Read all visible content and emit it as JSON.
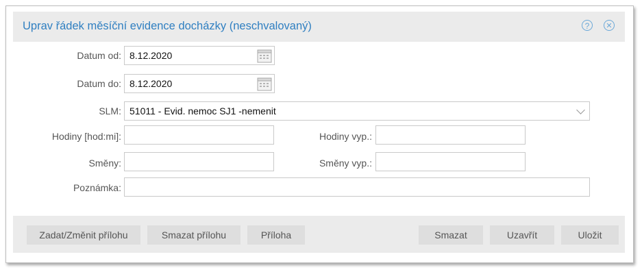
{
  "dialog": {
    "title": "Uprav řádek měsíční evidence docházky (neschvalovaný)",
    "help_icon": "question-circle-icon",
    "close_icon": "close-circle-icon",
    "accent_color": "#2f7fc1"
  },
  "form": {
    "datum_od": {
      "label": "Datum od:",
      "value": "8.12.2020"
    },
    "datum_do": {
      "label": "Datum do:",
      "value": "8.12.2020"
    },
    "slm": {
      "label": "SLM:",
      "value": "51011 - Evid. nemoc SJ1 -nemenit"
    },
    "hodiny": {
      "label": "Hodiny [hod:mi]:",
      "value": ""
    },
    "hodiny_vyp": {
      "label": "Hodiny vyp.:",
      "value": ""
    },
    "smeny": {
      "label": "Směny:",
      "value": ""
    },
    "smeny_vyp": {
      "label": "Směny vyp.:",
      "value": ""
    },
    "poznamka": {
      "label": "Poznámka:",
      "value": ""
    }
  },
  "buttons": {
    "zadat_prilohu": "Zadat/Změnit přílohu",
    "smazat_prilohu": "Smazat přílohu",
    "priloha": "Příloha",
    "smazat": "Smazat",
    "uzavrit": "Uzavřít",
    "ulozit": "Uložit"
  }
}
